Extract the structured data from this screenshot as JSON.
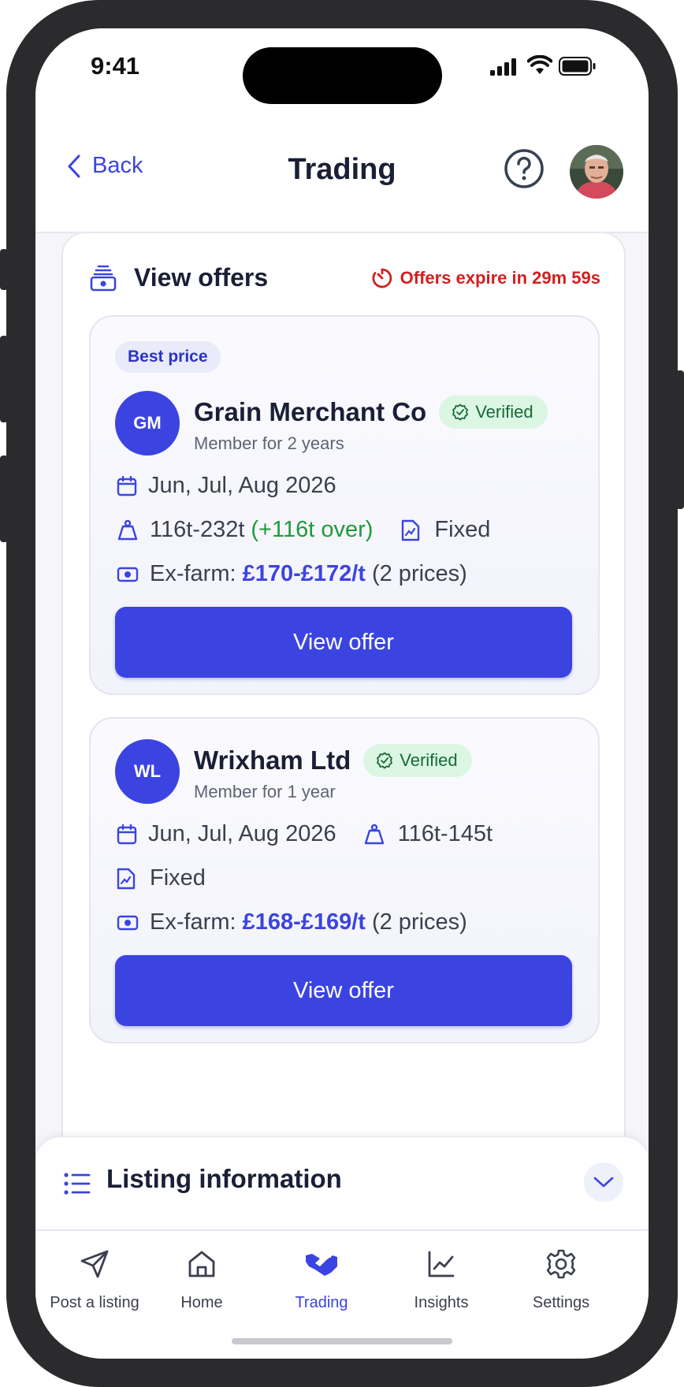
{
  "status_bar": {
    "time": "9:41"
  },
  "header": {
    "back_label": "Back",
    "title": "Trading"
  },
  "offers": {
    "title": "View offers",
    "expiry": "Offers expire in 29m 59s",
    "cards": [
      {
        "badge": "Best price",
        "initials": "GM",
        "company": "Grain Merchant Co",
        "verified": "Verified",
        "member": "Member for 2 years",
        "months": "Jun, Jul, Aug 2026",
        "quantity": "116t-232t",
        "quantity_extra": "(+116t over)",
        "contract": "Fixed",
        "price_prefix": "Ex-farm:",
        "price": "£170-£172/t",
        "price_suffix": "(2 prices)",
        "cta": "View offer"
      },
      {
        "initials": "WL",
        "company": "Wrixham Ltd",
        "verified": "Verified",
        "member": "Member for 1 year",
        "months": "Jun, Jul, Aug 2026",
        "quantity": "116t-145t",
        "contract": "Fixed",
        "price_prefix": "Ex-farm:",
        "price": "£168-£169/t",
        "price_suffix": "(2 prices)",
        "cta": "View offer"
      }
    ]
  },
  "listing": {
    "title": "Listing information"
  },
  "tabs": [
    {
      "label": "Post a listing",
      "icon": "send-icon"
    },
    {
      "label": "Home",
      "icon": "home-icon"
    },
    {
      "label": "Trading",
      "icon": "handshake-icon",
      "active": true
    },
    {
      "label": "Insights",
      "icon": "chart-icon"
    },
    {
      "label": "Settings",
      "icon": "gear-icon"
    }
  ],
  "colors": {
    "accent": "#3b44e0",
    "danger": "#d21f1f",
    "success": "#1f9a3b",
    "verified_bg": "#dcf6e4"
  }
}
